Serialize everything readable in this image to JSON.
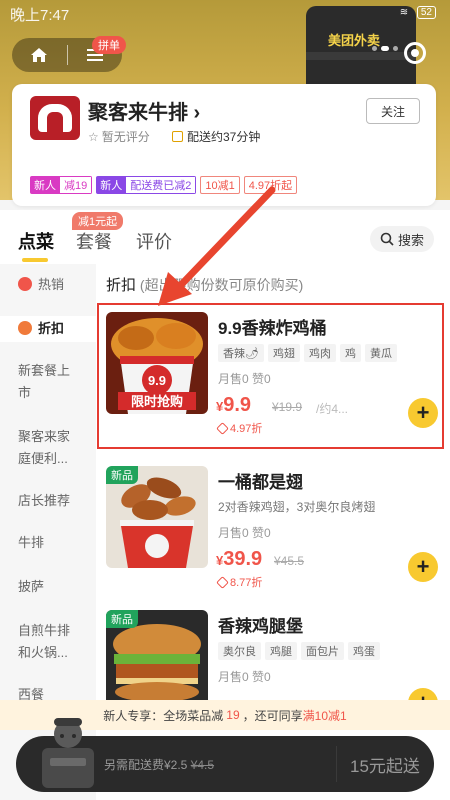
{
  "status_bar": {
    "time": "晚上7:47",
    "battery": "52"
  },
  "header": {
    "home_icon": "home-icon",
    "menu_icon": "menu-icon",
    "group_badge": "拼单",
    "bag_logo": "美团外卖"
  },
  "store": {
    "name": "聚客来牛排",
    "follow_label": "关注",
    "rating": "暂无评分",
    "delivery": "配送约37分钟",
    "tags": [
      {
        "a": "新人",
        "b": "减19"
      },
      {
        "a": "新人",
        "b": "配送费已减2"
      },
      {
        "text": "10减1"
      },
      {
        "text": "4.97折起"
      }
    ]
  },
  "tabs": {
    "items": [
      "点菜",
      "套餐",
      "评价"
    ],
    "promo": "减1元起",
    "search_label": "搜索"
  },
  "sidebar": {
    "items": [
      "热销",
      "折扣",
      "新套餐上市",
      "聚客来家庭便利...",
      "店长推荐",
      "牛排",
      "披萨",
      "自煎牛排和火锅...",
      "西餐"
    ]
  },
  "section": {
    "title": "折扣",
    "note": "(超出限购份数可原价购买)"
  },
  "dishes": [
    {
      "name": "9.9香辣炸鸡桶",
      "chips": [
        "香辣🌶",
        "鸡翅",
        "鸡肉",
        "鸡",
        "黄瓜"
      ],
      "sales": "月售0   赞0",
      "currency": "¥",
      "price": "9.9",
      "orig_price": "¥19.9",
      "unit": "/约4...",
      "discount": "4.97折",
      "img_text_1": "9.9",
      "img_text_2": "限时抢购"
    },
    {
      "badge": "新品",
      "name": "一桶都是翅",
      "desc": "2对香辣鸡翅，3对奥尔良烤翅",
      "sales": "月售0   赞0",
      "currency": "¥",
      "price": "39.9",
      "orig_price": "¥45.5",
      "discount": "8.77折"
    },
    {
      "badge": "新品",
      "name": "香辣鸡腿堡",
      "chips": [
        "奥尔良",
        "鸡腿",
        "面包片",
        "鸡蛋"
      ],
      "sales": "月售0   赞0"
    }
  ],
  "new_user_bar": {
    "prefix": "新人专享：全场菜品减",
    "amount": "19",
    "mid": "，还可同享",
    "deal": "满10减1"
  },
  "cart": {
    "fee_label": "另需配送费¥2.5",
    "fee_orig": "¥4.5",
    "start_label": "15元起送"
  }
}
